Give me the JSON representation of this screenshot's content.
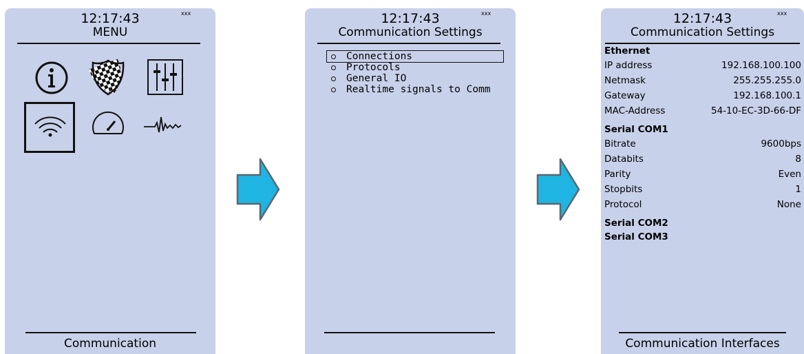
{
  "colors": {
    "screen_bg": "#c8d1ea",
    "arrow_fill": "#1fb4e1",
    "arrow_stroke": "#5b6670"
  },
  "screens": [
    {
      "time": "12:17:43",
      "corner": "xxx",
      "title": "MENU",
      "icons": [
        "info-icon",
        "shield-checkered-icon",
        "sliders-icon",
        "wireless-icon",
        "gauge-icon",
        "waveform-icon"
      ],
      "selected_icon": "wireless-icon",
      "footer": "Communication"
    },
    {
      "time": "12:17:43",
      "corner": "xxx",
      "title": "Communication Settings",
      "items": [
        "Connections",
        "Protocols",
        "General IO",
        "Realtime signals to Comm"
      ],
      "selected_item": "Connections",
      "footer": ""
    },
    {
      "time": "12:17:43",
      "corner": "xxx",
      "title": "Communication Settings",
      "ethernet": {
        "label": "Ethernet",
        "rows": [
          {
            "k": "IP address",
            "v": "192.168.100.100"
          },
          {
            "k": "Netmask",
            "v": "255.255.255.0"
          },
          {
            "k": "Gateway",
            "v": "192.168.100.1"
          },
          {
            "k": "MAC-Address",
            "v": "54-10-EC-3D-66-DF"
          }
        ]
      },
      "com1": {
        "label": "Serial COM1",
        "rows": [
          {
            "k": "Bitrate",
            "v": "9600bps"
          },
          {
            "k": "Databits",
            "v": "8"
          },
          {
            "k": "Parity",
            "v": "Even"
          },
          {
            "k": "Stopbits",
            "v": "1"
          },
          {
            "k": "Protocol",
            "v": "None"
          }
        ]
      },
      "com2": {
        "label": "Serial COM2"
      },
      "com3": {
        "label": "Serial COM3"
      },
      "footer": "Communication Interfaces"
    }
  ]
}
